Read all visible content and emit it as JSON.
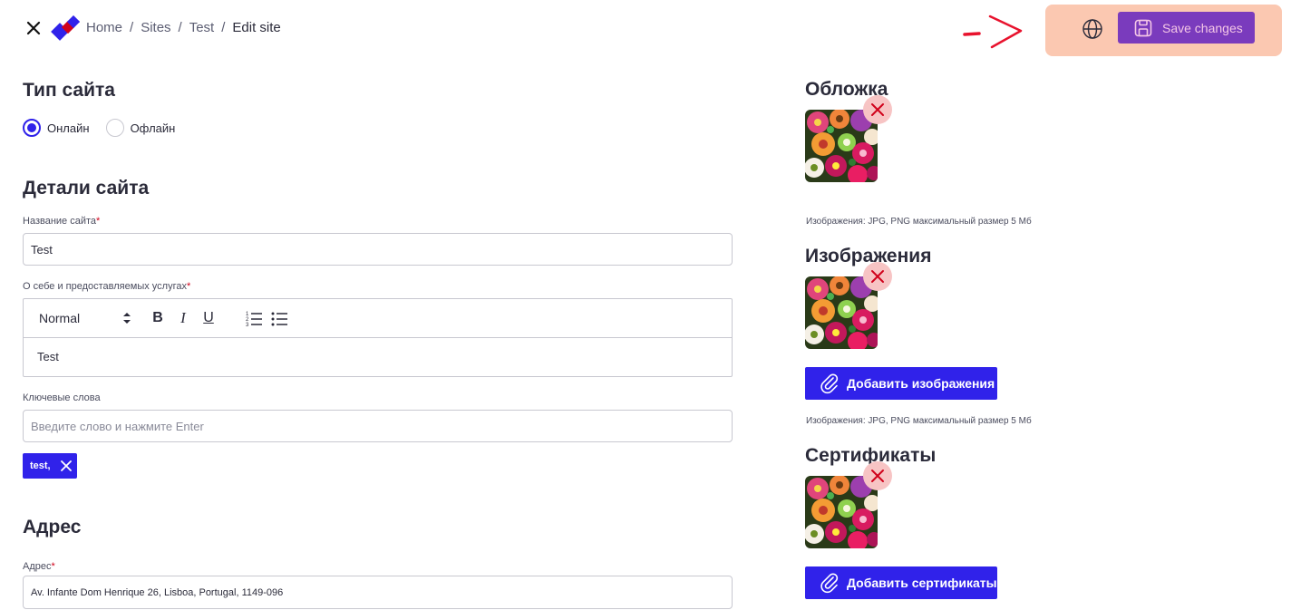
{
  "breadcrumb": {
    "home": "Home",
    "sites": "Sites",
    "test": "Test",
    "current": "Edit site",
    "separator": "/"
  },
  "toolbar": {
    "save_label": "Save changes"
  },
  "site_type": {
    "title": "Тип сайта",
    "options": [
      {
        "label": "Онлайн",
        "checked": true
      },
      {
        "label": "Офлайн",
        "checked": false
      }
    ]
  },
  "details": {
    "title": "Детали сайта",
    "name_label": "Название сайта",
    "name_value": "Test",
    "about_label": "О себе и предоставляемых услугах",
    "editor_format": "Normal",
    "editor_text": "Test",
    "keywords_label": "Ключевые слова",
    "keywords_placeholder": "Введите слово и нажмите Enter",
    "tags": [
      "test,"
    ]
  },
  "address": {
    "title": "Адрес",
    "label": "Адрес",
    "value": "Av. Infante Dom Henrique 26, Lisboa, Portugal, 1149-096"
  },
  "media": {
    "cover_title": "Обложка",
    "cover_hint": "Изображения: JPG, PNG максимальный размер 5 Мб",
    "images_title": "Изображения",
    "images_button": "Добавить изображения",
    "images_hint": "Изображения: JPG, PNG максимальный размер 5 Мб",
    "certs_title": "Сертификаты",
    "certs_button": "Добавить сертификаты"
  },
  "required_mark": "*",
  "colors": {
    "accent": "#3022ea",
    "save_button": "#7a3bbd",
    "highlight": "#fbc8b1",
    "delete_bg": "#f7c4c4",
    "delete_icon": "#d0021b"
  }
}
